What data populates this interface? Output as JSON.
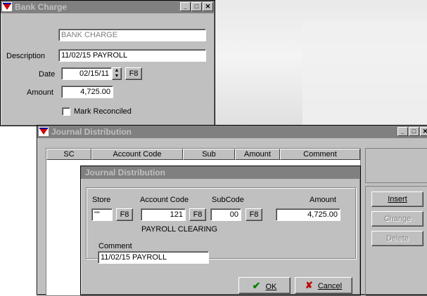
{
  "bank_charge": {
    "title": "Bank Charge",
    "type_field": "BANK CHARGE",
    "description_label": "Description",
    "description_value": "11/02/15 PAYROLL",
    "date_label": "Date",
    "date_value": "02/15/11",
    "date_lookup": "F8",
    "amount_label": "Amount",
    "amount_value": "4,725.00",
    "reconciled_label": "Mark Reconciled",
    "reconciled_checked": false
  },
  "journal_outer": {
    "title": "Journal Distribution",
    "columns": [
      "SC",
      "Account Code",
      "Sub",
      "Amount",
      "Comment"
    ],
    "buttons": {
      "insert": "Insert",
      "change": "Change",
      "delete": "Delete"
    }
  },
  "journal_dialog": {
    "title": "Journal Distribution",
    "store_label": "Store",
    "store_value": "\"\"",
    "account_label": "Account Code",
    "account_value": "121",
    "subcode_label": "SubCode",
    "subcode_value": "00",
    "amount_label": "Amount",
    "amount_value": "4,725.00",
    "lookup": "F8",
    "account_name": "PAYROLL CLEARING",
    "comment_label": "Comment",
    "comment_value": "11/02/15 PAYROLL",
    "ok_label": "OK",
    "cancel_label": "Cancel"
  },
  "colors": {
    "title_inactive": "#808080",
    "face": "#c0c0c0",
    "ok_check": "#008000",
    "cancel_x": "#c00000"
  }
}
